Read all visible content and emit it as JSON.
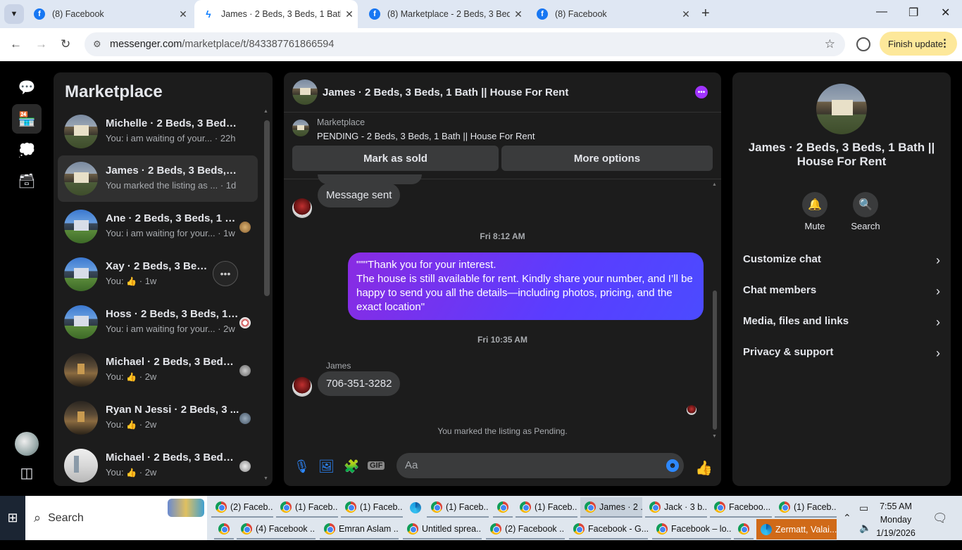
{
  "browser": {
    "tabs": [
      {
        "label": "(8) Facebook",
        "icon": "facebook-icon"
      },
      {
        "label": "James · 2 Beds, 3 Beds, 1 Bath ||",
        "icon": "messenger-icon"
      },
      {
        "label": "(8) Marketplace - 2 Beds, 3 Beds",
        "icon": "facebook-icon"
      },
      {
        "label": "(8) Facebook",
        "icon": "facebook-icon"
      }
    ],
    "url_host": "messenger.com",
    "url_path": "/marketplace/t/843387761866594",
    "update_label": "Finish update"
  },
  "sidebar": {
    "title": "Marketplace",
    "conversations": [
      {
        "name": "Michelle · 2 Beds, 3 Beds...",
        "preview": "You: i am waiting of your... · 22h",
        "thumb": "house"
      },
      {
        "name": "James · 2 Beds, 3 Beds, 1...",
        "preview": "You marked the listing as ... · 1d",
        "thumb": "house"
      },
      {
        "name": "Ane · 2 Beds, 3 Beds, 1 B...",
        "preview": "You: i am waiting for your... · 1w",
        "thumb": "blue"
      },
      {
        "name": "Xay · 2 Beds, 3 Beds, 1 B",
        "preview_prefix": "You:",
        "preview_suffix": "· 1w",
        "thumb": "blue"
      },
      {
        "name": "Hoss · 2 Beds, 3 Beds, 1 ...",
        "preview": "You: i am waiting for your... · 2w",
        "thumb": "blue"
      },
      {
        "name": "Michael · 2 Beds, 3 Beds,...",
        "preview_prefix": "You:",
        "preview_suffix": "· 2w",
        "thumb": "night"
      },
      {
        "name": "Ryan N Jessi · 2 Beds, 3 ...",
        "preview_prefix": "You:",
        "preview_suffix": "· 2w",
        "thumb": "night"
      },
      {
        "name": "Michael · 2 Beds, 3 Beds,...",
        "preview_prefix": "You:",
        "preview_suffix": "· 2w",
        "thumb": "white"
      }
    ]
  },
  "chat": {
    "title": "James · 2 Beds, 3 Beds, 1 Bath || House For Rent",
    "listing_source": "Marketplace",
    "listing_status": "PENDING - 2 Beds, 3 Beds, 1 Bath || House For Rent",
    "mark_sold_label": "Mark as sold",
    "more_options_label": "More options",
    "messages": {
      "sent_notice": "Message sent",
      "stamp1": "Fri 8:12 AM",
      "outgoing": "\"\"\"Thank you for your interest.\nThe house is still available for rent. Kindly share your number, and I’ll be happy to send you all the details—including photos, pricing, and the exact location\"",
      "stamp2": "Fri 10:35 AM",
      "sender_name": "James",
      "incoming": "706-351-3282",
      "system": "You marked the listing as Pending."
    },
    "input_placeholder": "Aa"
  },
  "info": {
    "name": "James · 2 Beds, 3 Beds, 1 Bath || House For Rent",
    "mute_label": "Mute",
    "search_label": "Search",
    "rows": [
      "Customize chat",
      "Chat members",
      "Media, files and links",
      "Privacy & support"
    ]
  },
  "taskbar": {
    "search_label": "Search",
    "row1": [
      "(2) Faceb...",
      "(1) Faceb...",
      "(1) Faceb...",
      "(1) Faceb...",
      "(1) Faceb...",
      "James · 2 ...",
      "Jack · 3 b...",
      "Faceboo...",
      "(1) Faceb..."
    ],
    "row2": [
      "(4) Facebook ...",
      "Emran Aslam ...",
      "Untitled sprea...",
      "(2) Facebook ...",
      "Facebook - G...",
      "Facebook – lo...",
      "Zermatt, Valai..."
    ],
    "time": "7:55 AM",
    "day": "Monday",
    "date": "1/19/2026"
  }
}
